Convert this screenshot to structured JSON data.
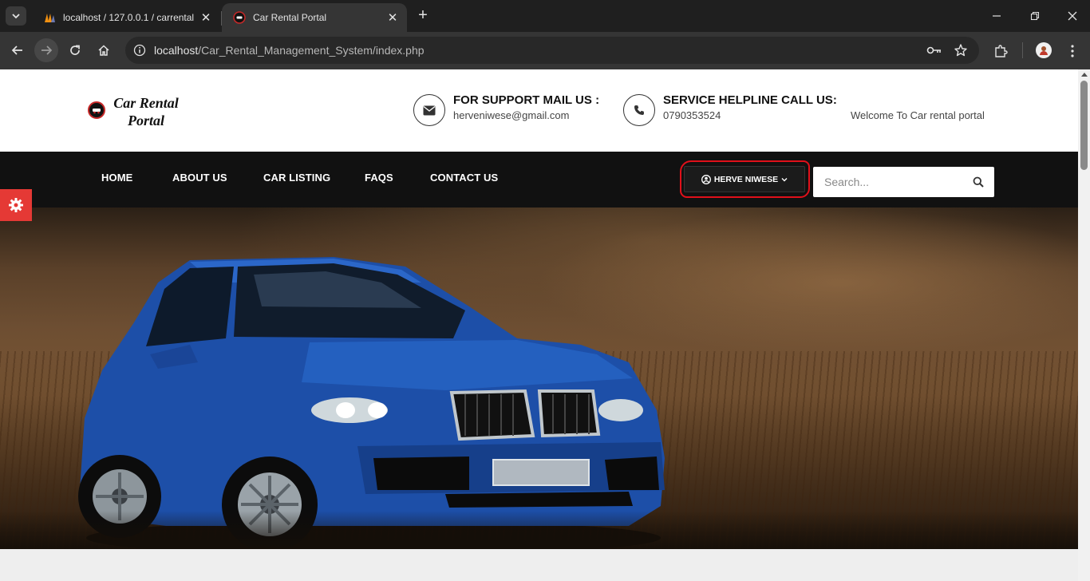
{
  "browser": {
    "tabs": [
      {
        "title": "localhost / 127.0.0.1 / carrental",
        "active": false,
        "favicon": "phpmyadmin-icon"
      },
      {
        "title": "Car Rental Portal",
        "active": true,
        "favicon": "car-rental-icon"
      }
    ],
    "url_host": "localhost",
    "url_path": "/Car_Rental_Management_System/index.php"
  },
  "header": {
    "logo_line1": "Car Rental",
    "logo_line2": "Portal",
    "support_title": "FOR SUPPORT MAIL US :",
    "support_email": "herveniwese@gmail.com",
    "helpline_title": "SERVICE HELPLINE CALL US:",
    "helpline_phone": "0790353524",
    "welcome": "Welcome To Car rental portal"
  },
  "nav": {
    "items": [
      {
        "label": "HOME"
      },
      {
        "label": "ABOUT US"
      },
      {
        "label": "CAR LISTING"
      },
      {
        "label": "FAQS"
      },
      {
        "label": "CONTACT US"
      }
    ],
    "user_label": "HERVE NIWESE",
    "search_placeholder": "Search..."
  },
  "colors": {
    "accent_red": "#e53935",
    "navbar_bg": "#111111",
    "highlight_ring": "#e0101a",
    "car_blue": "#1d4fa8"
  }
}
